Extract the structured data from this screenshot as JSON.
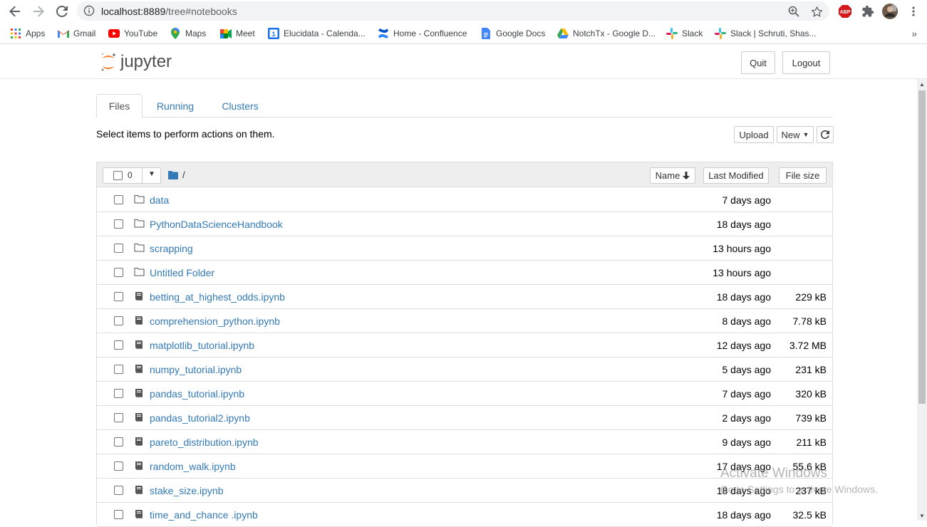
{
  "browser": {
    "url_host": "localhost:8889",
    "url_path": "/tree#notebooks",
    "extensions": [
      "abp-icon",
      "puzzle-icon",
      "profile-avatar",
      "kebab-menu-icon"
    ]
  },
  "bookmarks": [
    {
      "label": "Apps",
      "icon": "apps-grid-icon"
    },
    {
      "label": "Gmail",
      "icon": "gmail-icon"
    },
    {
      "label": "YouTube",
      "icon": "youtube-icon"
    },
    {
      "label": "Maps",
      "icon": "maps-icon"
    },
    {
      "label": "Meet",
      "icon": "meet-icon"
    },
    {
      "label": "Elucidata - Calenda...",
      "icon": "calendar-icon"
    },
    {
      "label": "Home - Confluence",
      "icon": "confluence-icon"
    },
    {
      "label": "Google Docs",
      "icon": "docs-icon"
    },
    {
      "label": "NotchTx - Google D...",
      "icon": "drive-icon"
    },
    {
      "label": "Slack",
      "icon": "slack-icon"
    },
    {
      "label": "Slack | Schruti, Shas...",
      "icon": "slack-icon"
    }
  ],
  "header": {
    "logo_text": "jupyter",
    "quit_label": "Quit",
    "logout_label": "Logout"
  },
  "tabs": [
    {
      "label": "Files",
      "active": true
    },
    {
      "label": "Running",
      "active": false
    },
    {
      "label": "Clusters",
      "active": false
    }
  ],
  "toolbar": {
    "hint": "Select items to perform actions on them.",
    "upload_label": "Upload",
    "new_label": "New"
  },
  "list_header": {
    "selected_count": "0",
    "path": "/",
    "sort_name": "Name",
    "sort_modified": "Last Modified",
    "sort_size": "File size"
  },
  "files": [
    {
      "name": "data",
      "type": "folder",
      "modified": "7 days ago",
      "size": ""
    },
    {
      "name": "PythonDataScienceHandbook",
      "type": "folder",
      "modified": "18 days ago",
      "size": ""
    },
    {
      "name": "scrapping",
      "type": "folder",
      "modified": "13 hours ago",
      "size": ""
    },
    {
      "name": "Untitled Folder",
      "type": "folder",
      "modified": "13 hours ago",
      "size": ""
    },
    {
      "name": "betting_at_highest_odds.ipynb",
      "type": "notebook",
      "modified": "18 days ago",
      "size": "229 kB"
    },
    {
      "name": "comprehension_python.ipynb",
      "type": "notebook",
      "modified": "8 days ago",
      "size": "7.78 kB"
    },
    {
      "name": "matplotlib_tutorial.ipynb",
      "type": "notebook",
      "modified": "12 days ago",
      "size": "3.72 MB"
    },
    {
      "name": "numpy_tutorial.ipynb",
      "type": "notebook",
      "modified": "5 days ago",
      "size": "231 kB"
    },
    {
      "name": "pandas_tutorial.ipynb",
      "type": "notebook",
      "modified": "7 days ago",
      "size": "320 kB"
    },
    {
      "name": "pandas_tutorial2.ipynb",
      "type": "notebook",
      "modified": "2 days ago",
      "size": "739 kB"
    },
    {
      "name": "pareto_distribution.ipynb",
      "type": "notebook",
      "modified": "9 days ago",
      "size": "211 kB"
    },
    {
      "name": "random_walk.ipynb",
      "type": "notebook",
      "modified": "17 days ago",
      "size": "55.6 kB"
    },
    {
      "name": "stake_size.ipynb",
      "type": "notebook",
      "modified": "18 days ago",
      "size": "237 kB"
    },
    {
      "name": "time_and_chance .ipynb",
      "type": "notebook",
      "modified": "18 days ago",
      "size": "32.5 kB"
    }
  ],
  "watermark": {
    "title": "Activate Windows",
    "subtitle": "Go to Settings to activate Windows."
  }
}
